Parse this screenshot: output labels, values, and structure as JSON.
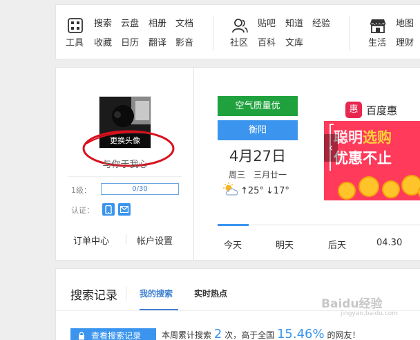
{
  "toolbar": {
    "tools": {
      "icon": "grid-icon",
      "label": "工具",
      "links": [
        "搜索",
        "云盘",
        "相册",
        "文档",
        "收藏",
        "日历",
        "翻译",
        "影音"
      ]
    },
    "community": {
      "icon": "people-icon",
      "label": "社区",
      "links": [
        "贴吧",
        "知道",
        "经验",
        "百科",
        "文库"
      ]
    },
    "life": {
      "icon": "store-icon",
      "label": "生活",
      "links": [
        "地图",
        "理财"
      ]
    }
  },
  "profile": {
    "change_avatar": "更换头像",
    "username": "与你于我心",
    "level_label": "1级：",
    "level_progress": "0/30",
    "verify_label": "认证：",
    "links": [
      "订单中心",
      "帐户设置"
    ]
  },
  "weather": {
    "air_quality": "空气质量优",
    "city": "衡阳",
    "date": "4月27日",
    "lunar": "周三　三月廿一",
    "temp_high": "↑25°",
    "temp_low": "↓17°",
    "icon": "sun-cloud-icon",
    "colors": {
      "air_quality": "#1fa23d",
      "city": "#3b95ee"
    }
  },
  "promo": {
    "logo_char": "惠",
    "brand": "百度惠",
    "line1_a": "聪明",
    "line1_b": "选购",
    "line2": "优惠不止",
    "prev": "‹"
  },
  "day_tabs": [
    "今天",
    "明天",
    "后天",
    "04.30"
  ],
  "history": {
    "title": "搜索记录",
    "tab_mine": "我的搜索",
    "tab_hot": "实时热点",
    "view_button": "查看搜索记录",
    "stats_a": "本周累计搜索",
    "stats_count": "2",
    "stats_b": "次，高于全国",
    "stats_percent": "15.46%",
    "stats_c": "的网友！"
  },
  "watermark": {
    "brand": "Baidu经验",
    "url": "jingyan.baidu.com"
  }
}
